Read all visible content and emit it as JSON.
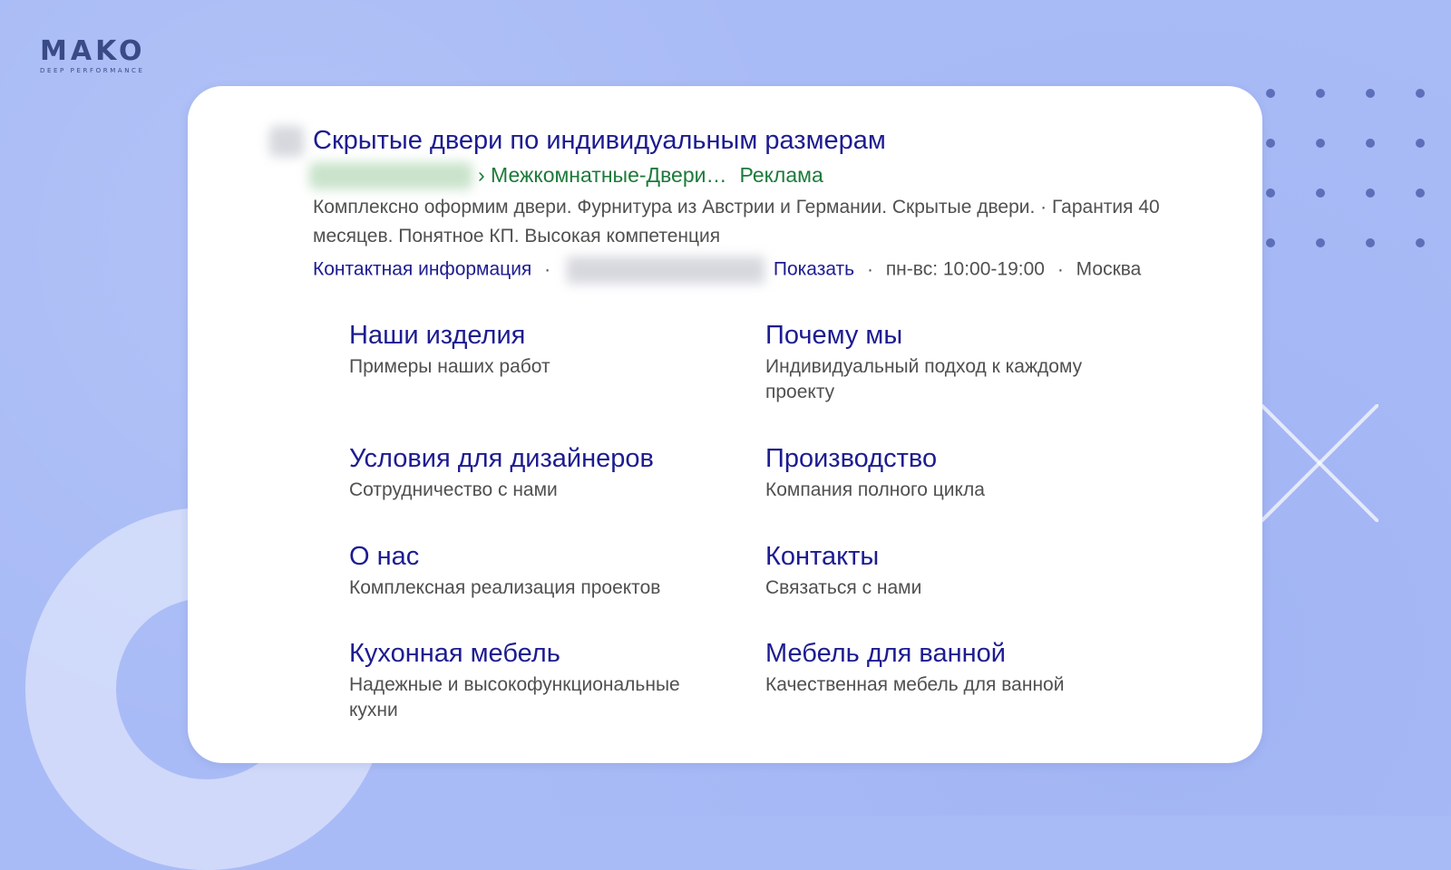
{
  "brand": {
    "logo_word": "MAKO",
    "logo_sub": "DEEP PERFORMANCE"
  },
  "ad": {
    "title": "Скрытые двери по индивидуальным размерам",
    "url_path": "› Межкомнатные-Двери…",
    "ad_label": "Реклама",
    "description": "Комплексно оформим двери. Фурнитура из Австрии и Германии. Скрытые двери. · Гарантия 40 месяцев. Понятное КП. Высокая компетенция",
    "meta": {
      "contact_link": "Контактная информация",
      "separator": "·",
      "show_link": "Показать",
      "hours": "пн-вс: 10:00-19:00",
      "city": "Москва"
    },
    "sitelinks": [
      {
        "title": "Наши изделия",
        "desc": "Примеры наших работ"
      },
      {
        "title": "Почему мы",
        "desc": "Индивидуальный подход к каждому проекту"
      },
      {
        "title": "Условия для дизайнеров",
        "desc": "Сотрудничество с нами"
      },
      {
        "title": "Производство",
        "desc": "Компания полного цикла"
      },
      {
        "title": "О нас",
        "desc": "Комплексная реализация проектов"
      },
      {
        "title": "Контакты",
        "desc": "Связаться с нами"
      },
      {
        "title": "Кухонная мебель",
        "desc": "Надежные и высокофункциональные кухни"
      },
      {
        "title": "Мебель для ванной",
        "desc": "Качественная мебель для ванной"
      }
    ]
  },
  "colors": {
    "background": "#a9bbf6",
    "link": "#1d1c91",
    "url_green": "#1d7a3a",
    "text_gray": "#505050"
  }
}
